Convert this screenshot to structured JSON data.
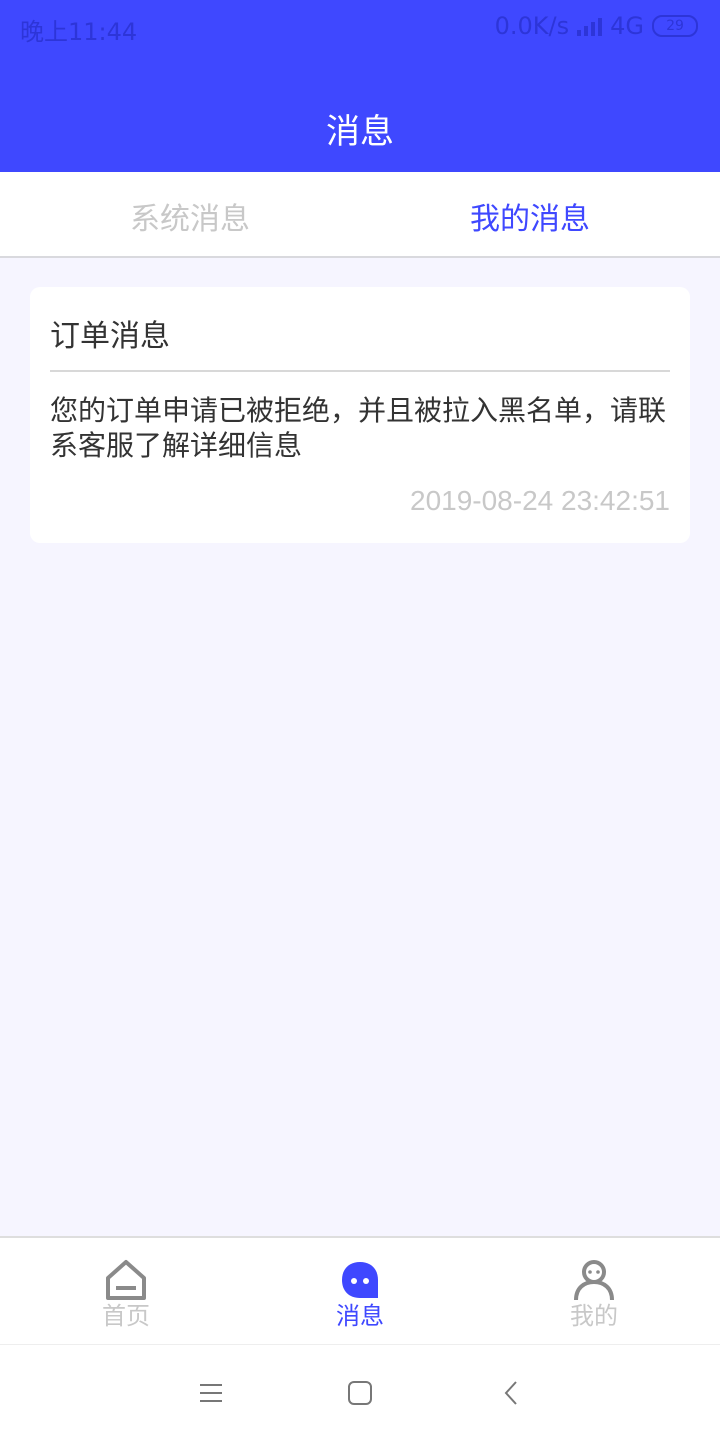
{
  "status_bar": {
    "time": "晚上11:44",
    "speed": "0.0K/s",
    "network": "4G",
    "battery": "29"
  },
  "header": {
    "title": "消息"
  },
  "tabs": [
    {
      "label": "系统消息",
      "active": false
    },
    {
      "label": "我的消息",
      "active": true
    }
  ],
  "messages": [
    {
      "title": "订单消息",
      "body": "您的订单申请已被拒绝，并且被拉入黑名单，请联系客服了解详细信息",
      "time": "2019-08-24 23:42:51"
    }
  ],
  "bottom_nav": [
    {
      "label": "首页",
      "icon": "home-icon",
      "active": false
    },
    {
      "label": "消息",
      "icon": "chat-bubble-icon",
      "active": true
    },
    {
      "label": "我的",
      "icon": "person-icon",
      "active": false
    }
  ],
  "colors": {
    "primary": "#3f48ff",
    "background": "#f6f5ff",
    "inactive": "#c8c8c8"
  }
}
